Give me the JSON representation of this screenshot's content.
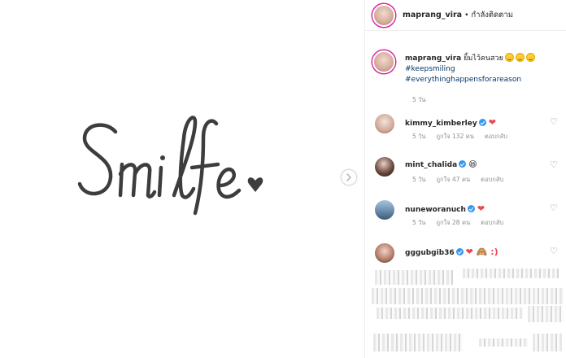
{
  "post_image": {
    "text": "Smile",
    "ink_color": "#3d3d3d"
  },
  "header": {
    "username": "maprang_vira",
    "separator": "•",
    "follow_status": "กำลังติดตาม"
  },
  "caption": {
    "username": "maprang_vira",
    "text": "ยิ้มไว้คนสวย",
    "emojis": [
      "smiling-face",
      "upside-down-face",
      "smiling-face"
    ],
    "hashtags": [
      "#keepsmiling",
      "#everythinghappensforareason"
    ],
    "time": "5 วัน"
  },
  "comments": [
    {
      "username": "kimmy_kimberley",
      "verified": true,
      "reaction": "❤",
      "time": "5 วัน",
      "likes": "ถูกใจ 132 คน",
      "reply": "ตอบกลับ"
    },
    {
      "username": "mint_chalida",
      "verified": true,
      "reaction": "😆",
      "time": "5 วัน",
      "likes": "ถูกใจ 47 คน",
      "reply": "ตอบกลับ"
    },
    {
      "username": "nuneworanuch",
      "verified": true,
      "reaction": "❤",
      "time": "5 วัน",
      "likes": "ถูกใจ 28 คน",
      "reply": "ตอบกลับ"
    },
    {
      "username": "gggubgib36",
      "verified": true,
      "reaction": "❤ 🙈 :)"
    }
  ],
  "colors": {
    "heart": "#ed4956",
    "verified": "#3897f0",
    "hashtag": "#003569",
    "muted": "#8e8e8e"
  }
}
